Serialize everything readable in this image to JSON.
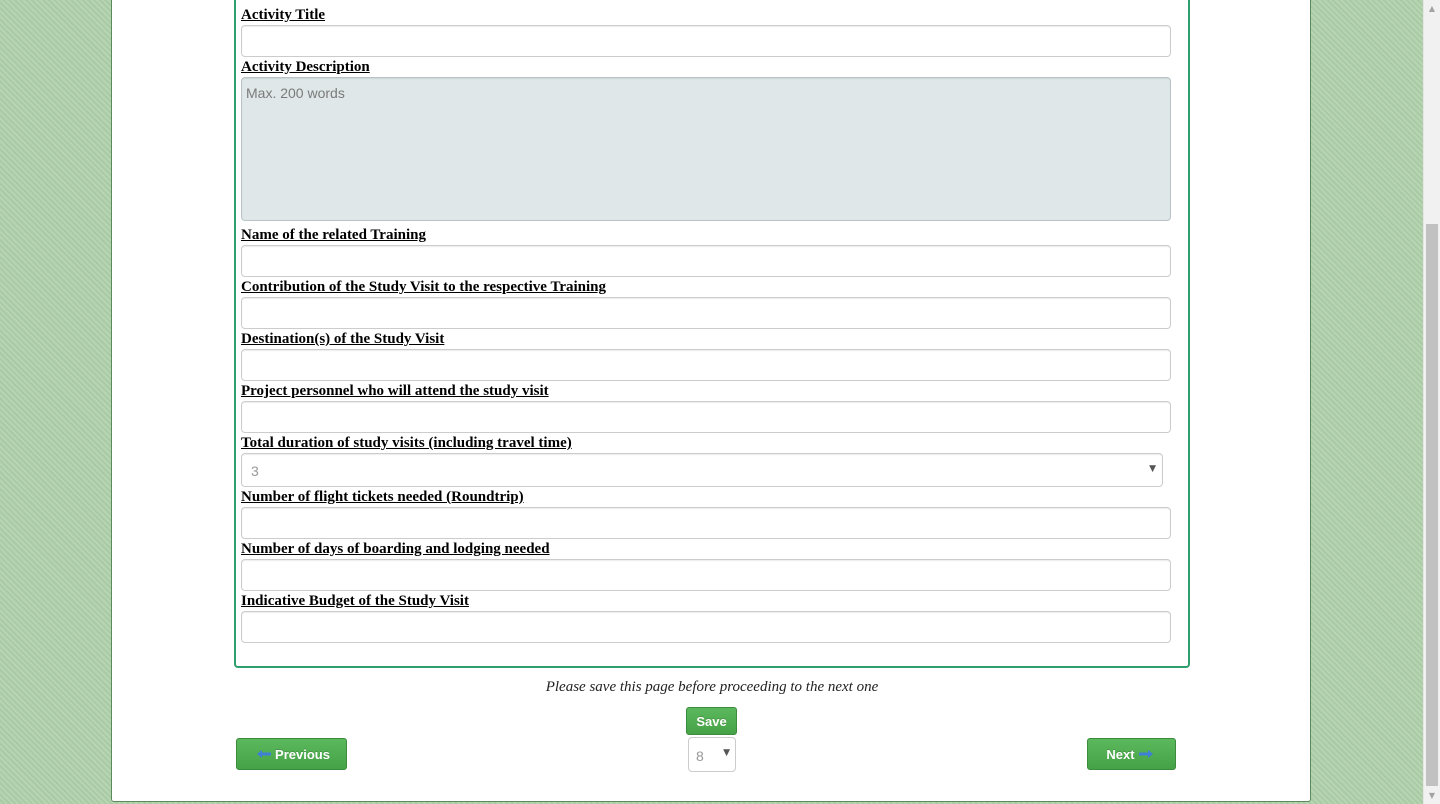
{
  "form": {
    "fields": [
      {
        "label": "Activity Title",
        "value": ""
      },
      {
        "label": "Activity Description",
        "value": "",
        "placeholder": "Max. 200 words"
      },
      {
        "label": "Name of the related Training",
        "value": ""
      },
      {
        "label": "Contribution of the Study Visit to the respective Training",
        "value": ""
      },
      {
        "label": "Destination(s) of the Study Visit",
        "value": ""
      },
      {
        "label": "Project personnel who will attend the study visit",
        "value": ""
      },
      {
        "label": "Total duration of study visits (including travel time)",
        "value": "3"
      },
      {
        "label": "Number of flight tickets needed (Roundtrip)",
        "value": ""
      },
      {
        "label": "Number of days of boarding and lodging needed",
        "value": ""
      },
      {
        "label": "Indicative Budget of the Study Visit",
        "value": ""
      }
    ]
  },
  "footer": {
    "save_note": "Please save this page before proceeding to the next one",
    "save_label": "Save",
    "previous_label": "Previous",
    "next_label": "Next",
    "page_number": "8"
  },
  "icons": {
    "caret": "chevron-down-icon",
    "previous": "arrow-left-icon",
    "next": "arrow-right-icon"
  },
  "colors": {
    "background": "#b0d1ab",
    "panel_border": "#2e9e6e",
    "button_green": "#5cb85c",
    "arrow_blue": "#3f7fd6",
    "textarea_bg": "#dfe7e8"
  }
}
